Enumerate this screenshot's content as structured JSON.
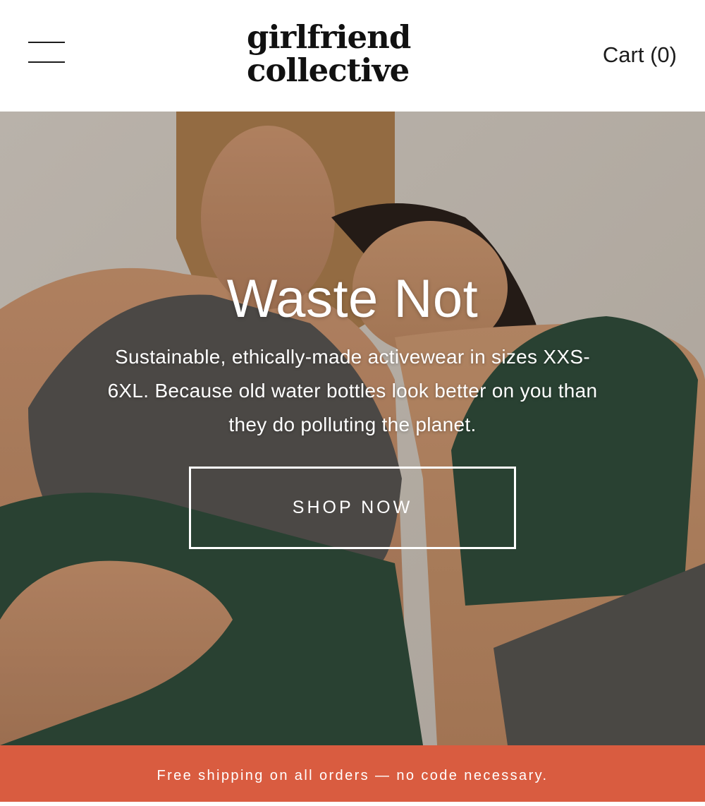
{
  "header": {
    "logo_line1": "girlfriend",
    "logo_line2": "collective",
    "cart_label": "Cart (0)"
  },
  "hero": {
    "title": "Waste Not",
    "subtitle": "Sustainable, ethically-made activewear in sizes XXS-6XL. Because old water bottles look better on you than they do polluting the planet.",
    "cta_label": "SHOP NOW"
  },
  "promo": {
    "text": "Free shipping on all orders — no code necessary."
  },
  "icons": {
    "menu": "hamburger-menu-icon"
  },
  "colors": {
    "promo_bar": "#d95c40",
    "header_bg": "#ffffff",
    "text_dark": "#1c1c1c",
    "hero_text": "#ffffff"
  }
}
